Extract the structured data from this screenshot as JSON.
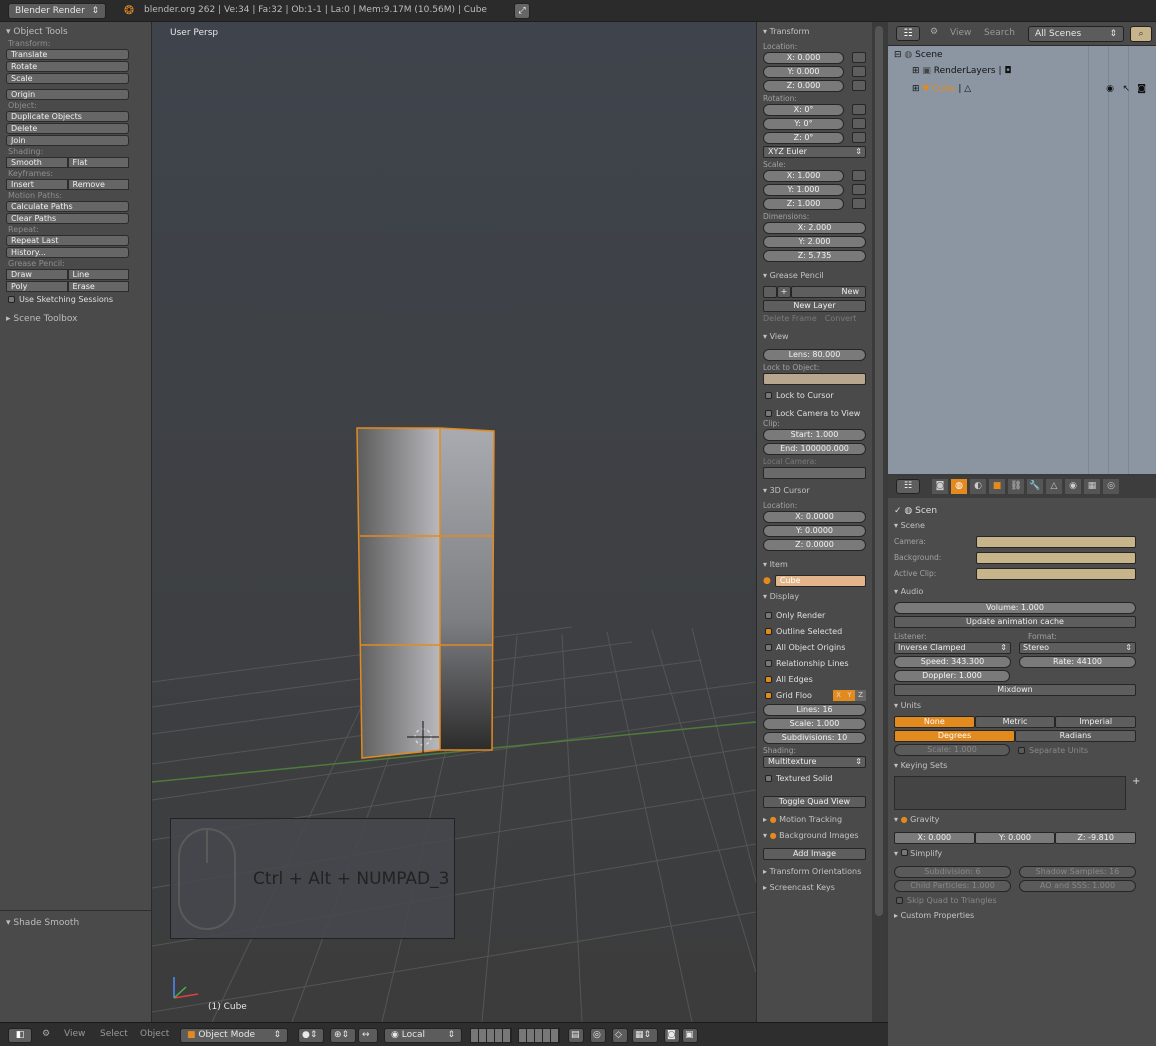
{
  "topbar": {
    "render_engine": "Blender Render",
    "stats": "blender.org 262 | Ve:34 | Fa:32 | Ob:1-1 | La:0 | Mem:9.17M (10.56M) | Cube"
  },
  "tools": {
    "header": "Object Tools",
    "transform_label": "Transform:",
    "translate": "Translate",
    "rotate": "Rotate",
    "scale": "Scale",
    "origin": "Origin",
    "object_label": "Object:",
    "duplicate": "Duplicate Objects",
    "delete": "Delete",
    "join": "Join",
    "shading_label": "Shading:",
    "smooth": "Smooth",
    "flat": "Flat",
    "keyframes_label": "Keyframes:",
    "insert": "Insert",
    "remove": "Remove",
    "motion_label": "Motion Paths:",
    "calc_paths": "Calculate Paths",
    "clear_paths": "Clear Paths",
    "repeat_label": "Repeat:",
    "repeat_last": "Repeat Last",
    "history": "History...",
    "gp_label": "Grease Pencil:",
    "draw": "Draw",
    "line": "Line",
    "poly": "Poly",
    "erase": "Erase",
    "sketching": "Use Sketching Sessions",
    "scene_toolbox": "Scene Toolbox",
    "shade_smooth": "Shade Smooth"
  },
  "viewport": {
    "view_name": "User Persp",
    "object_label": "(1) Cube",
    "key_hint": "Ctrl + Alt + NUMPAD_3"
  },
  "nprops": {
    "transform": "Transform",
    "location_label": "Location:",
    "loc": [
      "X: 0.000",
      "Y: 0.000",
      "Z: 0.000"
    ],
    "rotation_label": "Rotation:",
    "rot": [
      "X: 0°",
      "Y: 0°",
      "Z: 0°"
    ],
    "euler": "XYZ Euler",
    "scale_label": "Scale:",
    "scale": [
      "X: 1.000",
      "Y: 1.000",
      "Z: 1.000"
    ],
    "dims_label": "Dimensions:",
    "dims": [
      "X: 2.000",
      "Y: 2.000",
      "Z: 5.735"
    ],
    "grease_pencil": "Grease Pencil",
    "gp_new": "New",
    "gp_new_layer": "New Layer",
    "gp_delete_frame": "Delete Frame",
    "gp_convert": "Convert",
    "view": "View",
    "lens": "Lens: 80.000",
    "lock_to_object": "Lock to Object:",
    "lock_cursor": "Lock to Cursor",
    "lock_camera": "Lock Camera to View",
    "clip_label": "Clip:",
    "clip_start": "Start: 1.000",
    "clip_end": "End: 100000.000",
    "local_camera": "Local Camera:",
    "cursor3d": "3D Cursor",
    "cursor_loc_label": "Location:",
    "cursor": [
      "X: 0.0000",
      "Y: 0.0000",
      "Z: 0.0000"
    ],
    "item": "Item",
    "item_name": "Cube",
    "display": "Display",
    "only_render": "Only Render",
    "outline_selected": "Outline Selected",
    "all_origins": "All Object Origins",
    "relationship_lines": "Relationship Lines",
    "all_edges": "All Edges",
    "grid_floor": "Grid Floo",
    "axes": [
      "X",
      "Y",
      "Z"
    ],
    "lines": "Lines: 16",
    "grid_scale": "Scale: 1.000",
    "subdivisions": "Subdivisions: 10",
    "shading_label": "Shading:",
    "shading_value": "Multitexture",
    "textured_solid": "Textured Solid",
    "toggle_quad": "Toggle Quad View",
    "motion_tracking": "Motion Tracking",
    "background_images": "Background Images",
    "add_image": "Add Image",
    "transform_orientations": "Transform Orientations",
    "screencast_keys": "Screencast Keys"
  },
  "outliner": {
    "view": "View",
    "search": "Search",
    "scenes": "All Scenes",
    "scene": "Scene",
    "render_layers": "RenderLayers",
    "cube": "Cube"
  },
  "scene_props": {
    "crumb": "Scen",
    "scene_header": "Scene",
    "camera_label": "Camera:",
    "background_label": "Background:",
    "active_clip_label": "Active Clip:",
    "audio": "Audio",
    "volume": "Volume: 1.000",
    "update_cache": "Update animation cache",
    "listener_label": "Listener:",
    "format_label": "Format:",
    "listener": "Inverse Clamped",
    "format": "Stereo",
    "speed": "Speed: 343.300",
    "rate": "Rate: 44100",
    "doppler": "Doppler: 1.000",
    "mixdown": "Mixdown",
    "units": "Units",
    "unit_none": "None",
    "unit_metric": "Metric",
    "unit_imperial": "Imperial",
    "degrees": "Degrees",
    "radians": "Radians",
    "unit_scale": "Scale: 1.000",
    "separate_units": "Separate Units",
    "keying_sets": "Keying Sets",
    "gravity": "Gravity",
    "grav": [
      "X: 0.000",
      "Y: 0.000",
      "Z: -9.810"
    ],
    "simplify": "Simplify",
    "subdivision": "Subdivision: 6",
    "shadow_samples": "Shadow Samples: 16",
    "child_particles": "Child Particles: 1.000",
    "ao_sss": "AO and SSS: 1.000",
    "skip_quad": "Skip Quad to Triangles",
    "custom_props": "Custom Properties"
  },
  "bottombar": {
    "view": "View",
    "select": "Select",
    "object": "Object",
    "mode": "Object Mode",
    "pivot": "Local"
  },
  "colors": {
    "accent": "#e38a1f",
    "outliner_bg": "#8c96a3"
  }
}
